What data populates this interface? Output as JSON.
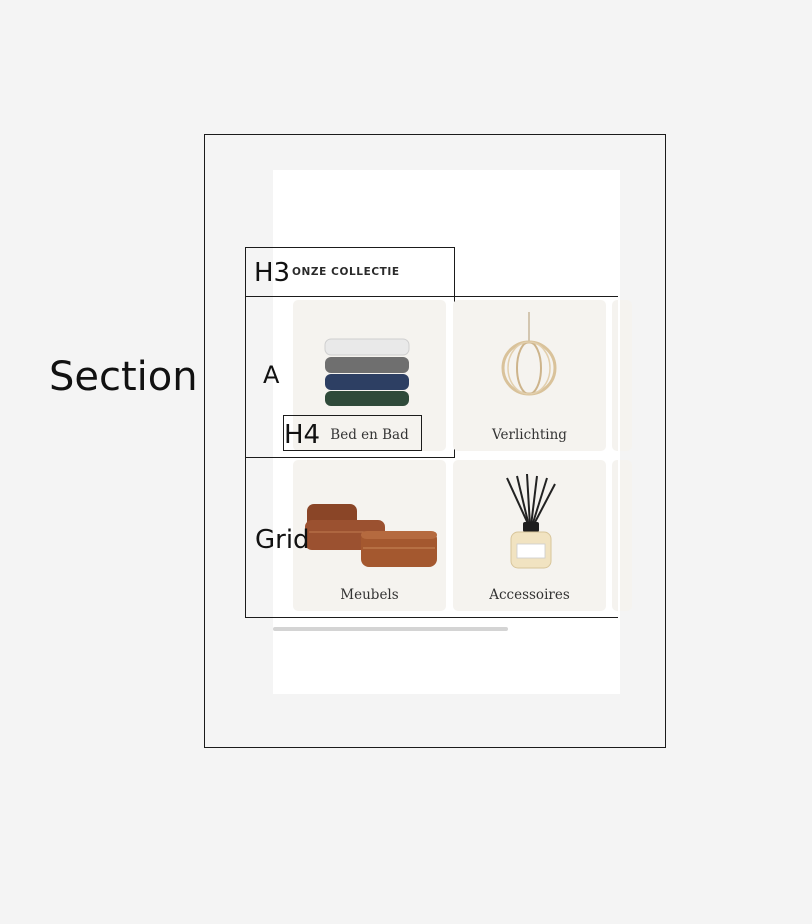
{
  "annotations": {
    "section": "Section",
    "h3": "H3",
    "a": "A",
    "h4": "H4",
    "grid": "Grid"
  },
  "collection": {
    "heading": "ONZE COLLECTIE",
    "items": [
      {
        "label": "Bed en Bad",
        "icon": "towel-stack-icon"
      },
      {
        "label": "Verlichting",
        "icon": "pendant-lamp-icon"
      },
      {
        "label": "Meubels",
        "icon": "leather-pouf-icon"
      },
      {
        "label": "Accessoires",
        "icon": "reed-diffuser-icon"
      }
    ]
  },
  "colors": {
    "card_bg": "#f5f3ef",
    "outline": "#1b1b1b",
    "page_bg": "#f4f4f4"
  }
}
